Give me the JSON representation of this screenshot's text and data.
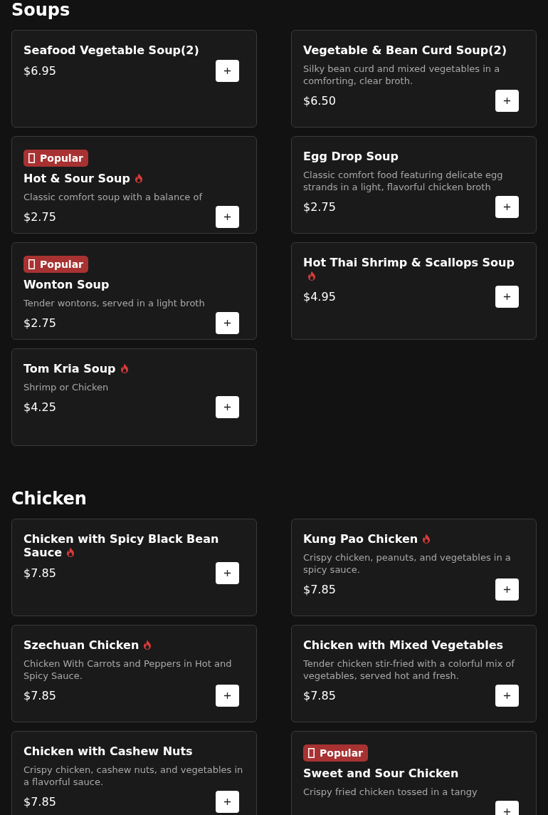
{
  "sections": [
    {
      "title": "Soups",
      "items": [
        {
          "name": "Seafood Vegetable Soup(2)",
          "spicy": false,
          "price": "$6.95"
        },
        {
          "name": "Vegetable & Bean Curd Soup(2)",
          "spicy": false,
          "description": "Silky bean curd and mixed vegetables in a comforting, clear broth.",
          "price": "$6.50"
        },
        {
          "badge": "Popular",
          "name": "Hot & Sour Soup",
          "spicy": true,
          "description": "Classic comfort soup with a balance of",
          "price": "$2.75"
        },
        {
          "name": "Egg Drop Soup",
          "spicy": false,
          "description": "Classic comfort food featuring delicate egg strands in a light, flavorful chicken broth",
          "price": "$2.75"
        },
        {
          "badge": "Popular",
          "name": "Wonton Soup",
          "spicy": false,
          "description": "Tender wontons, served in a light broth",
          "price": "$2.75"
        },
        {
          "name": "Hot Thai Shrimp & Scallops Soup",
          "spicy": true,
          "price": "$4.95"
        },
        {
          "name": "Tom Kria Soup",
          "spicy": true,
          "description": "Shrimp or Chicken",
          "price": "$4.25"
        }
      ]
    },
    {
      "title": "Chicken",
      "items": [
        {
          "name": "Chicken with Spicy Black Bean Sauce",
          "spicy": true,
          "price": "$7.85"
        },
        {
          "name": "Kung Pao Chicken",
          "spicy": true,
          "description": "Crispy chicken, peanuts, and vegetables in a spicy sauce.",
          "price": "$7.85"
        },
        {
          "name": "Szechuan Chicken",
          "spicy": true,
          "description": "Chicken With Carrots and Peppers in Hot and Spicy Sauce.",
          "price": "$7.85"
        },
        {
          "name": "Chicken with Mixed Vegetables",
          "spicy": false,
          "description": "Tender chicken stir-fried with a colorful mix of vegetables, served hot and fresh.",
          "price": "$7.85"
        },
        {
          "name": "Chicken with Cashew Nuts",
          "spicy": false,
          "description": "Crispy chicken, cashew nuts, and vegetables in a flavorful sauce.",
          "price": "$7.85"
        },
        {
          "badge": "Popular",
          "name": "Sweet and Sour Chicken",
          "spicy": false,
          "description": "Crispy fried chicken tossed in a tangy"
        }
      ]
    }
  ]
}
